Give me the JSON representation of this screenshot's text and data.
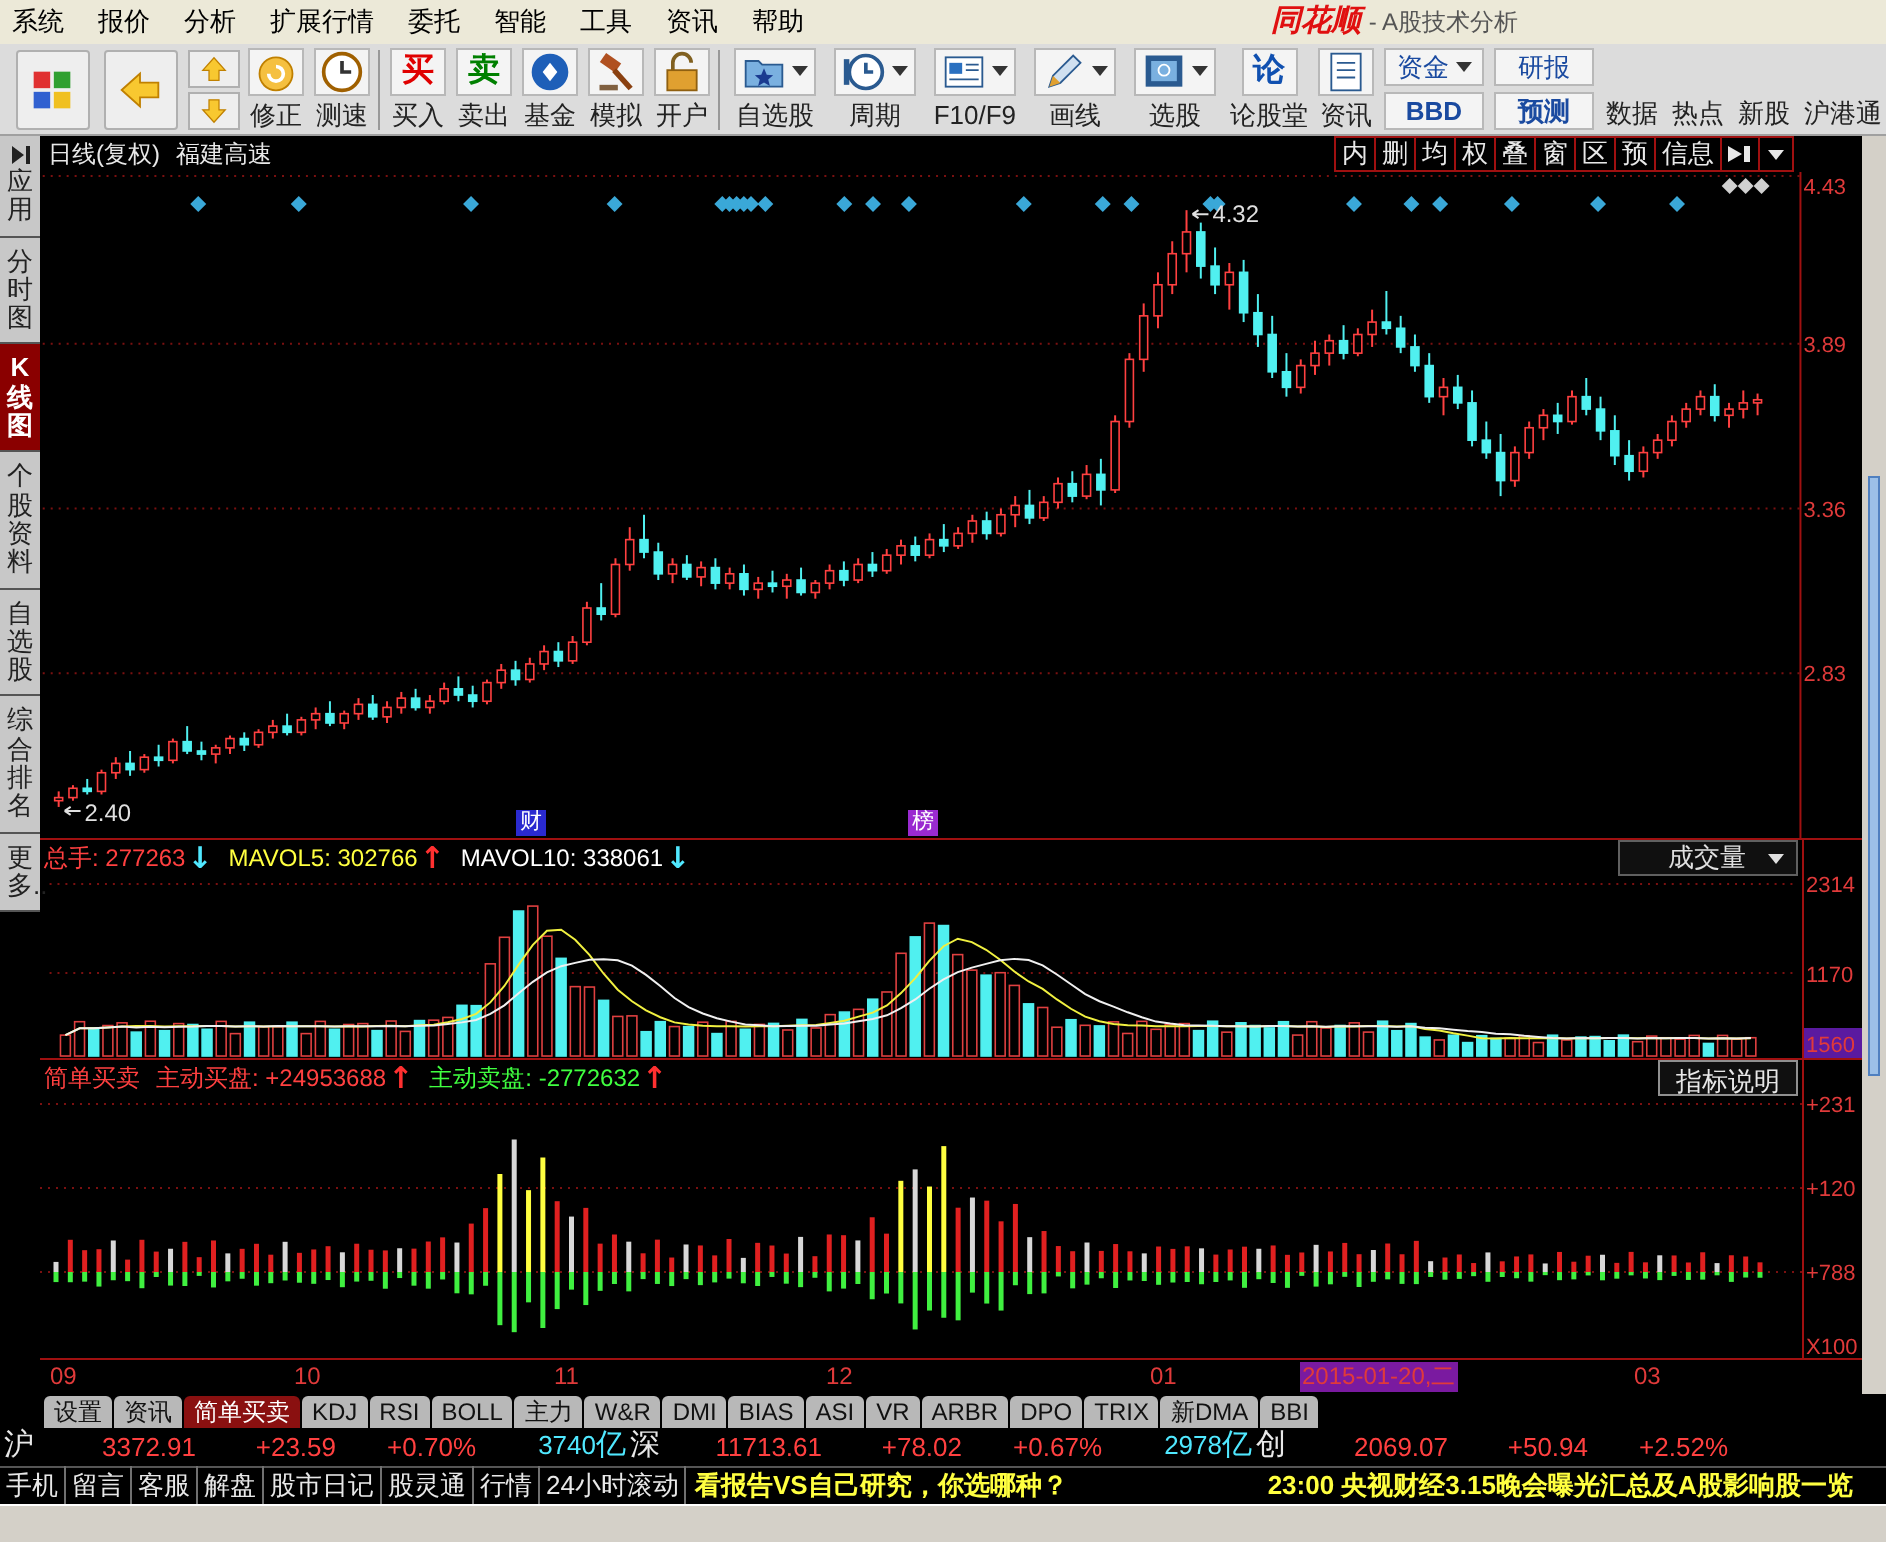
{
  "menu": [
    "系统",
    "报价",
    "分析",
    "扩展行情",
    "委托",
    "智能",
    "工具",
    "资讯",
    "帮助"
  ],
  "title": {
    "logo": "同花顺",
    "text": "- A股技术分析"
  },
  "toolbar": [
    {
      "kind": "icon_button"
    },
    {
      "kind": "icon_button"
    },
    {
      "kind": "arrows"
    },
    {
      "kind": "button",
      "label": "修正"
    },
    {
      "kind": "button",
      "label": "测速"
    },
    {
      "kind": "separator"
    },
    {
      "kind": "glyph_button",
      "glyph": "买",
      "label": "买入",
      "color": "#e00000"
    },
    {
      "kind": "glyph_button",
      "glyph": "卖",
      "label": "卖出",
      "color": "#008000"
    },
    {
      "kind": "button",
      "label": "基金"
    },
    {
      "kind": "button",
      "label": "模拟"
    },
    {
      "kind": "button",
      "label": "开户"
    },
    {
      "kind": "separator"
    },
    {
      "kind": "dropdown",
      "label": "自选股"
    },
    {
      "kind": "dropdown",
      "label": "周期"
    },
    {
      "kind": "dropdown",
      "label": "F10/F9"
    },
    {
      "kind": "dropdown",
      "label": "画线"
    },
    {
      "kind": "dropdown",
      "label": "选股"
    },
    {
      "kind": "glyph_button",
      "glyph": "论",
      "label": "论股堂",
      "color": "#1050b0"
    },
    {
      "kind": "button",
      "label": "资讯"
    },
    {
      "kind": "stack",
      "labels": [
        {
          "text": "资金",
          "dropdown": true
        },
        {
          "text": "BBD",
          "dropdown": false
        }
      ]
    },
    {
      "kind": "stack",
      "labels": [
        {
          "text": "研报",
          "dropdown": false
        },
        {
          "text": "预测",
          "dropdown": false
        }
      ]
    },
    {
      "kind": "text",
      "label": "数据"
    },
    {
      "kind": "text",
      "label": "热点"
    },
    {
      "kind": "text",
      "label": "新股"
    },
    {
      "kind": "text",
      "label": "沪港通"
    }
  ],
  "sidebar": [
    {
      "label": "应用",
      "selected": false
    },
    {
      "label": "分时图",
      "selected": false
    },
    {
      "label": "K线图",
      "selected": true
    },
    {
      "label": "个股资料",
      "selected": false
    },
    {
      "label": "自选股",
      "selected": false
    },
    {
      "label": "综合排名",
      "selected": false
    },
    {
      "label": "更多..",
      "selected": false
    }
  ],
  "price_panel": {
    "period": "日线(复权)",
    "stock": "福建高速",
    "tools": [
      "内",
      "删",
      "均",
      "权",
      "叠",
      "窗",
      "区",
      "预",
      "信息"
    ],
    "high_label": "4.32",
    "low_label": "2.40",
    "event_marks": [
      {
        "text": "财",
        "color": "#2a2ad0"
      },
      {
        "text": "榜",
        "color": "#9a2ad0"
      }
    ],
    "chart_data": {
      "type": "candlestick",
      "grid": true,
      "ylim": [
        2.3,
        4.43
      ],
      "yticks": [
        4.43,
        3.89,
        3.36,
        2.83
      ],
      "ohlc": [
        [
          2.42,
          2.45,
          2.4,
          2.43
        ],
        [
          2.43,
          2.47,
          2.42,
          2.46
        ],
        [
          2.46,
          2.49,
          2.44,
          2.45
        ],
        [
          2.45,
          2.52,
          2.44,
          2.51
        ],
        [
          2.51,
          2.56,
          2.49,
          2.54
        ],
        [
          2.54,
          2.58,
          2.5,
          2.52
        ],
        [
          2.52,
          2.57,
          2.51,
          2.56
        ],
        [
          2.56,
          2.6,
          2.53,
          2.55
        ],
        [
          2.55,
          2.62,
          2.54,
          2.61
        ],
        [
          2.61,
          2.66,
          2.57,
          2.58
        ],
        [
          2.58,
          2.61,
          2.55,
          2.57
        ],
        [
          2.57,
          2.6,
          2.54,
          2.59
        ],
        [
          2.59,
          2.63,
          2.57,
          2.62
        ],
        [
          2.62,
          2.64,
          2.58,
          2.6
        ],
        [
          2.6,
          2.65,
          2.59,
          2.64
        ],
        [
          2.64,
          2.68,
          2.62,
          2.66
        ],
        [
          2.66,
          2.7,
          2.63,
          2.64
        ],
        [
          2.64,
          2.69,
          2.63,
          2.68
        ],
        [
          2.68,
          2.72,
          2.65,
          2.7
        ],
        [
          2.7,
          2.74,
          2.66,
          2.67
        ],
        [
          2.67,
          2.71,
          2.65,
          2.7
        ],
        [
          2.7,
          2.75,
          2.68,
          2.73
        ],
        [
          2.73,
          2.76,
          2.68,
          2.69
        ],
        [
          2.69,
          2.74,
          2.67,
          2.72
        ],
        [
          2.72,
          2.77,
          2.7,
          2.75
        ],
        [
          2.75,
          2.78,
          2.71,
          2.72
        ],
        [
          2.72,
          2.76,
          2.7,
          2.74
        ],
        [
          2.74,
          2.8,
          2.73,
          2.78
        ],
        [
          2.78,
          2.82,
          2.74,
          2.76
        ],
        [
          2.76,
          2.79,
          2.72,
          2.74
        ],
        [
          2.74,
          2.81,
          2.73,
          2.8
        ],
        [
          2.8,
          2.86,
          2.78,
          2.84
        ],
        [
          2.84,
          2.87,
          2.79,
          2.81
        ],
        [
          2.81,
          2.88,
          2.8,
          2.86
        ],
        [
          2.86,
          2.92,
          2.84,
          2.9
        ],
        [
          2.9,
          2.93,
          2.85,
          2.87
        ],
        [
          2.87,
          2.95,
          2.86,
          2.93
        ],
        [
          2.93,
          3.06,
          2.92,
          3.04
        ],
        [
          3.04,
          3.12,
          3.0,
          3.02
        ],
        [
          3.02,
          3.2,
          3.01,
          3.18
        ],
        [
          3.18,
          3.3,
          3.16,
          3.26
        ],
        [
          3.26,
          3.34,
          3.2,
          3.22
        ],
        [
          3.22,
          3.25,
          3.13,
          3.15
        ],
        [
          3.15,
          3.2,
          3.12,
          3.18
        ],
        [
          3.18,
          3.21,
          3.13,
          3.14
        ],
        [
          3.14,
          3.19,
          3.11,
          3.17
        ],
        [
          3.17,
          3.2,
          3.1,
          3.12
        ],
        [
          3.12,
          3.17,
          3.1,
          3.15
        ],
        [
          3.15,
          3.18,
          3.08,
          3.1
        ],
        [
          3.1,
          3.14,
          3.07,
          3.12
        ],
        [
          3.12,
          3.16,
          3.09,
          3.11
        ],
        [
          3.11,
          3.15,
          3.07,
          3.13
        ],
        [
          3.13,
          3.17,
          3.08,
          3.09
        ],
        [
          3.09,
          3.13,
          3.07,
          3.12
        ],
        [
          3.12,
          3.18,
          3.1,
          3.16
        ],
        [
          3.16,
          3.19,
          3.11,
          3.13
        ],
        [
          3.13,
          3.2,
          3.12,
          3.18
        ],
        [
          3.18,
          3.22,
          3.14,
          3.16
        ],
        [
          3.16,
          3.23,
          3.15,
          3.21
        ],
        [
          3.21,
          3.26,
          3.18,
          3.24
        ],
        [
          3.24,
          3.27,
          3.19,
          3.21
        ],
        [
          3.21,
          3.28,
          3.2,
          3.26
        ],
        [
          3.26,
          3.31,
          3.22,
          3.24
        ],
        [
          3.24,
          3.3,
          3.23,
          3.28
        ],
        [
          3.28,
          3.34,
          3.25,
          3.32
        ],
        [
          3.32,
          3.35,
          3.26,
          3.28
        ],
        [
          3.28,
          3.36,
          3.27,
          3.34
        ],
        [
          3.34,
          3.4,
          3.3,
          3.37
        ],
        [
          3.37,
          3.42,
          3.31,
          3.33
        ],
        [
          3.33,
          3.4,
          3.32,
          3.38
        ],
        [
          3.38,
          3.46,
          3.36,
          3.44
        ],
        [
          3.44,
          3.48,
          3.38,
          3.4
        ],
        [
          3.4,
          3.5,
          3.39,
          3.47
        ],
        [
          3.47,
          3.52,
          3.37,
          3.42
        ],
        [
          3.42,
          3.66,
          3.41,
          3.64
        ],
        [
          3.64,
          3.86,
          3.62,
          3.84
        ],
        [
          3.84,
          4.02,
          3.8,
          3.98
        ],
        [
          3.98,
          4.12,
          3.94,
          4.08
        ],
        [
          4.08,
          4.22,
          4.05,
          4.18
        ],
        [
          4.18,
          4.32,
          4.12,
          4.25
        ],
        [
          4.25,
          4.28,
          4.1,
          4.14
        ],
        [
          4.14,
          4.2,
          4.05,
          4.08
        ],
        [
          4.08,
          4.15,
          4.0,
          4.12
        ],
        [
          4.12,
          4.16,
          3.96,
          3.99
        ],
        [
          3.99,
          4.05,
          3.88,
          3.92
        ],
        [
          3.92,
          3.98,
          3.78,
          3.8
        ],
        [
          3.8,
          3.86,
          3.72,
          3.75
        ],
        [
          3.75,
          3.84,
          3.73,
          3.82
        ],
        [
          3.82,
          3.9,
          3.79,
          3.86
        ],
        [
          3.86,
          3.92,
          3.82,
          3.9
        ],
        [
          3.9,
          3.95,
          3.84,
          3.86
        ],
        [
          3.86,
          3.94,
          3.85,
          3.92
        ],
        [
          3.92,
          4.0,
          3.88,
          3.96
        ],
        [
          3.96,
          4.06,
          3.92,
          3.94
        ],
        [
          3.94,
          3.98,
          3.86,
          3.88
        ],
        [
          3.88,
          3.92,
          3.8,
          3.82
        ],
        [
          3.82,
          3.86,
          3.7,
          3.72
        ],
        [
          3.72,
          3.78,
          3.66,
          3.75
        ],
        [
          3.75,
          3.79,
          3.68,
          3.7
        ],
        [
          3.7,
          3.74,
          3.56,
          3.58
        ],
        [
          3.58,
          3.64,
          3.52,
          3.54
        ],
        [
          3.54,
          3.6,
          3.4,
          3.45
        ],
        [
          3.45,
          3.56,
          3.43,
          3.54
        ],
        [
          3.54,
          3.64,
          3.52,
          3.62
        ],
        [
          3.62,
          3.68,
          3.58,
          3.66
        ],
        [
          3.66,
          3.7,
          3.6,
          3.64
        ],
        [
          3.64,
          3.74,
          3.63,
          3.72
        ],
        [
          3.72,
          3.78,
          3.66,
          3.68
        ],
        [
          3.68,
          3.72,
          3.58,
          3.61
        ],
        [
          3.61,
          3.66,
          3.5,
          3.53
        ],
        [
          3.53,
          3.58,
          3.45,
          3.48
        ],
        [
          3.48,
          3.56,
          3.46,
          3.54
        ],
        [
          3.54,
          3.6,
          3.52,
          3.58
        ],
        [
          3.58,
          3.66,
          3.56,
          3.64
        ],
        [
          3.64,
          3.7,
          3.62,
          3.68
        ],
        [
          3.68,
          3.74,
          3.66,
          3.72
        ],
        [
          3.72,
          3.76,
          3.64,
          3.66
        ],
        [
          3.66,
          3.7,
          3.62,
          3.68
        ],
        [
          3.68,
          3.74,
          3.65,
          3.7
        ],
        [
          3.7,
          3.73,
          3.66,
          3.71
        ]
      ]
    }
  },
  "volume_panel": {
    "readings": [
      {
        "text": "总手: 277263",
        "color": "#ff4040",
        "arrow": {
          "text": "↓",
          "color": "#50e8ff"
        }
      },
      {
        "text": "MAVOL5: 302766",
        "color": "#ffff40",
        "arrow": {
          "text": "↑",
          "color": "#ff3030"
        }
      },
      {
        "text": "MAVOL10: 338061",
        "color": "#ffffff",
        "arrow": {
          "text": "↓",
          "color": "#50e8ff"
        }
      }
    ],
    "selector": "成交量",
    "axis": [
      "2314",
      "1170"
    ],
    "current": "1560"
  },
  "indicator_panel": {
    "readings": [
      {
        "text": "简单买卖",
        "color": "#ff4040"
      },
      {
        "text": "主动买盘: +24953688",
        "color": "#ff4040",
        "arrow": {
          "text": "↑",
          "color": "#ff3030"
        }
      },
      {
        "text": "主动卖盘: -2772632",
        "color": "#40ff40",
        "arrow": {
          "text": "↑",
          "color": "#ff3030"
        }
      }
    ],
    "help": "指标说明",
    "axis": [
      "+231",
      "+120",
      "+788",
      "X100"
    ]
  },
  "dates": [
    {
      "text": "09",
      "selected": false
    },
    {
      "text": "10",
      "selected": false
    },
    {
      "text": "11",
      "selected": false
    },
    {
      "text": "12",
      "selected": false
    },
    {
      "text": "01",
      "selected": false
    },
    {
      "text": "2015-01-20,二",
      "selected": true
    },
    {
      "text": "03",
      "selected": false
    }
  ],
  "indicator_tabs": [
    {
      "label": "设置",
      "selected": false
    },
    {
      "label": "资讯",
      "selected": false
    },
    {
      "label": "简单买卖",
      "selected": true
    },
    {
      "label": "KDJ",
      "selected": false
    },
    {
      "label": "RSI",
      "selected": false
    },
    {
      "label": "BOLL",
      "selected": false
    },
    {
      "label": "主力",
      "selected": false
    },
    {
      "label": "W&R",
      "selected": false
    },
    {
      "label": "DMI",
      "selected": false
    },
    {
      "label": "BIAS",
      "selected": false
    },
    {
      "label": "ASI",
      "selected": false
    },
    {
      "label": "VR",
      "selected": false
    },
    {
      "label": "ARBR",
      "selected": false
    },
    {
      "label": "DPO",
      "selected": false
    },
    {
      "label": "TRIX",
      "selected": false
    },
    {
      "label": "新DMA",
      "selected": false
    },
    {
      "label": "BBI",
      "selected": false
    }
  ],
  "indices": [
    {
      "market": "沪",
      "price": "3372.91",
      "change": "+23.59",
      "pct": "+0.70%",
      "turnover": "3740",
      "unit": "亿"
    },
    {
      "market": "深",
      "price": "11713.61",
      "change": "+78.02",
      "pct": "+0.67%",
      "turnover": "2978",
      "unit": "亿"
    },
    {
      "market": "创",
      "price": "2069.07",
      "change": "+50.94",
      "pct": "+2.52%"
    }
  ],
  "news_links": [
    "手机",
    "留言",
    "客服",
    "解盘",
    "股市日记",
    "股灵通",
    "行情",
    "24小时滚动"
  ],
  "headlines": [
    "看报告VS自己研究，你选哪种？",
    "23:00 央视财经3.15晚会曝光汇总及A股影响股一览"
  ]
}
